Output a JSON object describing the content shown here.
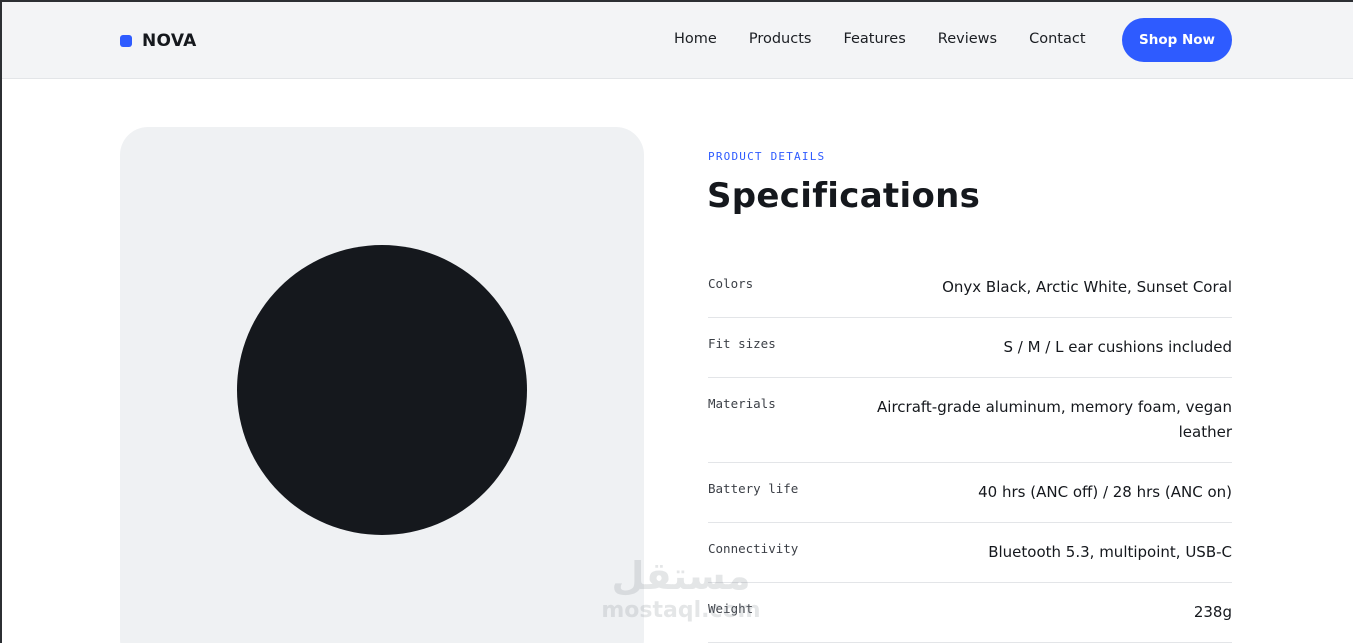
{
  "header": {
    "brand": "NOVA",
    "nav": [
      "Home",
      "Products",
      "Features",
      "Reviews",
      "Contact"
    ],
    "cta_label": "Shop Now"
  },
  "specs": {
    "eyebrow": "PRODUCT DETAILS",
    "title": "Specifications",
    "rows": [
      {
        "label": "Colors",
        "value": "Onyx Black, Arctic White, Sunset Coral"
      },
      {
        "label": "Fit sizes",
        "value": "S / M / L ear cushions included"
      },
      {
        "label": "Materials",
        "value": "Aircraft-grade aluminum, memory foam, vegan leather"
      },
      {
        "label": "Battery life",
        "value": "40 hrs (ANC off) / 28 hrs (ANC on)"
      },
      {
        "label": "Connectivity",
        "value": "Bluetooth 5.3, multipoint, USB-C"
      },
      {
        "label": "Weight",
        "value": "238g"
      }
    ]
  },
  "watermark": {
    "arabic": "مستقل",
    "latin": "mostaql.com"
  },
  "colors": {
    "accent": "#2e5bff",
    "product": "#15181d",
    "panel": "#eff1f3"
  }
}
